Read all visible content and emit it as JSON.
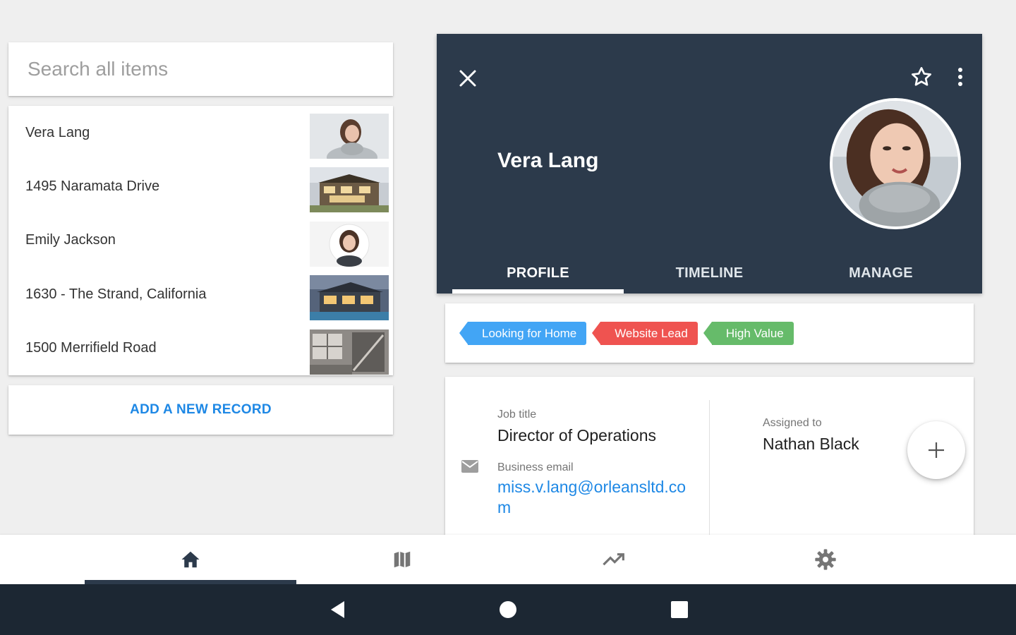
{
  "search": {
    "placeholder": "Search all items",
    "value": ""
  },
  "list": {
    "items": [
      {
        "label": "Vera Lang",
        "thumb": "person-photo"
      },
      {
        "label": "1495 Naramata Drive",
        "thumb": "house-photo"
      },
      {
        "label": "Emily Jackson",
        "thumb": "person-photo"
      },
      {
        "label": "1630 - The Strand, California",
        "thumb": "house-photo"
      },
      {
        "label": "1500 Merrifield Road",
        "thumb": "interior-photo"
      }
    ],
    "add_label": "ADD A NEW RECORD"
  },
  "header": {
    "name": "Vera Lang",
    "bg_color": "#2c3a4b",
    "icons": {
      "close": "close-icon",
      "star": "star-outline-icon",
      "more": "more-vert-icon"
    },
    "tabs": [
      {
        "label": "PROFILE",
        "active": true
      },
      {
        "label": "TIMELINE",
        "active": false
      },
      {
        "label": "MANAGE",
        "active": false
      }
    ]
  },
  "tags": [
    {
      "label": "Looking for Home",
      "color": "#42a5f5"
    },
    {
      "label": "Website Lead",
      "color": "#ef5350"
    },
    {
      "label": "High Value",
      "color": "#66bb6a"
    }
  ],
  "details": {
    "job_title_label": "Job title",
    "job_title": "Director of Operations",
    "email_label": "Business email",
    "email": "miss.v.lang@orleansltd.com",
    "assigned_label": "Assigned to",
    "assigned": "Nathan Black",
    "fab_icon": "plus-icon"
  },
  "bottom_nav": [
    {
      "icon": "home-icon",
      "active": true
    },
    {
      "icon": "map-icon",
      "active": false
    },
    {
      "icon": "trending-up-icon",
      "active": false
    },
    {
      "icon": "settings-icon",
      "active": false
    }
  ],
  "system_nav": [
    "back-icon",
    "home-circle-icon",
    "recents-icon"
  ]
}
